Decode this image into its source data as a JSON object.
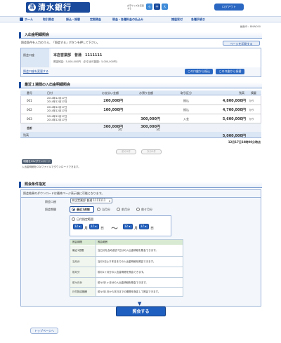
{
  "header": {
    "bank_name": "清水銀行",
    "logo_mark": "清",
    "fontsize_label": "文字サイズを変更する",
    "fontsize_buttons": [
      "小",
      "中",
      "大"
    ],
    "logout": "ログアウト"
  },
  "nav": {
    "items": [
      "ホーム",
      "取引照会",
      "振込・振替",
      "定期預金",
      "税金・各種料金の払込み",
      "諸届受付",
      "各種手続き"
    ]
  },
  "screen_id": "画面ID：BNW050",
  "section1": {
    "title": "入出金明細照会",
    "instruction": "照会条件を入力のうえ、「照会する」ボタンを押して下さい。",
    "help_button": "ページを印刷する",
    "account_label": "照会口座",
    "account_value": "本店営業部　普通　1111111",
    "balance_line": "預金残高：5,000,000円　(お引出可能額：5,000,000円)",
    "change_account_link": "照会口座を変更する",
    "btn_other_account_1": "この口座から振込",
    "btn_other_account_2": "この口座から振替"
  },
  "section2": {
    "title": "最近１週間の入出金明細照会",
    "columns": [
      "番号",
      "日付",
      "お支払い金額",
      "お預り金額",
      "取引区分",
      "残高",
      "摘要"
    ],
    "rows": [
      {
        "no": "001",
        "date1": "2014年12月17日",
        "date2": "2014年12月17日",
        "payment": "200,000円",
        "deposit": "",
        "type": "振込",
        "balance": "4,800,000円",
        "memo": "ｶﾄｳ"
      },
      {
        "no": "002",
        "date1": "2014年12月17日",
        "date2": "2014年12月17日",
        "payment": "100,000円",
        "deposit": "",
        "type": "振込",
        "balance": "4,700,000円",
        "memo": "ｶﾄｳ"
      },
      {
        "no": "003",
        "date1": "2014年12月17日",
        "date2": "2014年12月17日",
        "payment": "",
        "deposit": "300,000円",
        "type": "入金",
        "balance": "5,600,000円",
        "memo": "ｶﾄｳ"
      }
    ],
    "total_label": "合計",
    "total_payment": "300,000円",
    "total_payment_count": "2件",
    "total_deposit": "300,000円",
    "total_deposit_count": "1件",
    "balance_label": "残高",
    "balance_value": "5,000,000円",
    "as_of": "12月17日10時00分時点",
    "prev_button": "前の5件",
    "next_button": "次の5件"
  },
  "csv": {
    "button": "明細をCSVダウンロード",
    "note": "入出金明細をCSVファイルでダウンロードできます。"
  },
  "section3": {
    "title": "照会条件指定",
    "note": "照会結果のダウンロードは最終ページ表示後に可能となります。",
    "account_label": "照会口座",
    "account_select": "本店営業部 普通 1111111",
    "period_label": "照会期間",
    "period_options": [
      "最近1週間",
      "当月分",
      "前月分",
      "前々月分"
    ],
    "date_range_label": "日付指定範囲",
    "month_from": "12",
    "day_from": "17",
    "month_to": "12",
    "day_to": "17",
    "unit_month": "月",
    "unit_day": "日",
    "tilde": "～",
    "table_headers": [
      "照会期間",
      "照会範囲"
    ],
    "table_rows": [
      [
        "最近1週間",
        "当日分を含め過去7日分の入出金明細を照会できます。"
      ],
      [
        "当月分",
        "当月1日より本日までの入出金明細を照会できます。"
      ],
      [
        "前月分",
        "前月1ヶ月分の入出金明細を照会できます。"
      ],
      [
        "前々月分",
        "前々月1ヶ月分の入出金明細を照会できます。"
      ],
      [
        "日付指定範囲",
        "前々月1日から本日までの期間を指定して照会できます。"
      ]
    ],
    "submit": "照会する"
  },
  "footer": {
    "top_button": "トップページへ"
  }
}
